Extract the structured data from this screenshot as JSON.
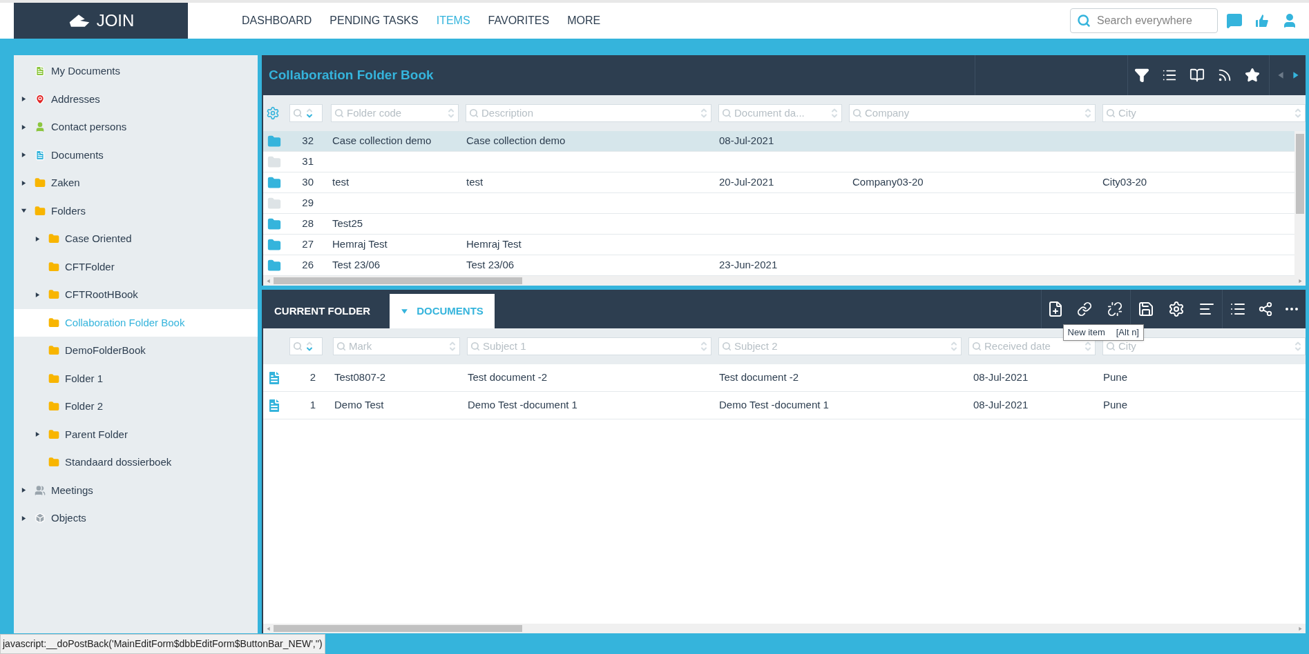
{
  "topbar": {
    "logo": "JOIN",
    "menu": [
      {
        "label": "DASHBOARD",
        "selected": false
      },
      {
        "label": "PENDING TASKS",
        "selected": false
      },
      {
        "label": "ITEMS",
        "selected": true
      },
      {
        "label": "FAVORITES",
        "selected": false
      },
      {
        "label": "MORE",
        "selected": false
      }
    ],
    "search": {
      "placeholder": "Search everywhere"
    }
  },
  "sidebar": {
    "items": [
      {
        "label": "My Documents",
        "kind": "document",
        "selected": false
      },
      {
        "label": "Addresses",
        "kind": "pin",
        "expanded": false,
        "selected": false
      },
      {
        "label": "Contact persons",
        "kind": "person",
        "expanded": false,
        "selected": false
      },
      {
        "label": "Documents",
        "kind": "file",
        "expanded": false,
        "selected": false
      },
      {
        "label": "Zaken",
        "kind": "folder",
        "expanded": false,
        "selected": false
      },
      {
        "label": "Folders",
        "kind": "folder",
        "expanded": true,
        "selected": false,
        "children": [
          {
            "label": "Case Oriented",
            "kind": "folder",
            "expanded": false,
            "selected": false
          },
          {
            "label": "CFTFolder",
            "kind": "folder",
            "selected": false
          },
          {
            "label": "CFTRootHBook",
            "kind": "folder",
            "expanded": false,
            "selected": false
          },
          {
            "label": "Collaboration Folder Book",
            "kind": "folder",
            "selected": true
          },
          {
            "label": "DemoFolderBook",
            "kind": "folder",
            "selected": false
          },
          {
            "label": "Folder 1",
            "kind": "folder",
            "selected": false
          },
          {
            "label": "Folder 2",
            "kind": "folder",
            "selected": false
          },
          {
            "label": "Parent Folder",
            "kind": "folder",
            "expanded": false,
            "selected": false
          },
          {
            "label": "Standaard dossierboek",
            "kind": "folder",
            "selected": false
          }
        ]
      },
      {
        "label": "Meetings",
        "kind": "people",
        "expanded": false,
        "selected": false
      },
      {
        "label": "Objects",
        "kind": "box",
        "expanded": false,
        "selected": false
      }
    ]
  },
  "folder_list": {
    "title": "Collaboration Folder Book",
    "filters": [
      "Folder code",
      "Description",
      "Document da...",
      "Company",
      "City"
    ],
    "rows": [
      {
        "number": "32",
        "folder_code": "Case collection demo",
        "description": "Case collection demo",
        "document_date": "08-Jul-2021",
        "company": "",
        "city": "",
        "empty": false,
        "selected": true
      },
      {
        "number": "31",
        "folder_code": "",
        "description": "",
        "document_date": "",
        "company": "",
        "city": "",
        "empty": true,
        "selected": false
      },
      {
        "number": "30",
        "folder_code": "test",
        "description": "test",
        "document_date": "20-Jul-2021",
        "company": "Company03-20",
        "city": "City03-20",
        "empty": false,
        "selected": false
      },
      {
        "number": "29",
        "folder_code": "",
        "description": "",
        "document_date": "",
        "company": "",
        "city": "",
        "empty": true,
        "selected": false
      },
      {
        "number": "28",
        "folder_code": "Test25",
        "description": "",
        "document_date": "",
        "company": "",
        "city": "",
        "empty": false,
        "selected": false
      },
      {
        "number": "27",
        "folder_code": "Hemraj Test",
        "description": "Hemraj Test",
        "document_date": "",
        "company": "",
        "city": "",
        "empty": false,
        "selected": false
      },
      {
        "number": "26",
        "folder_code": "Test 23/06",
        "description": "Test 23/06",
        "document_date": "23-Jun-2021",
        "company": "",
        "city": "",
        "empty": false,
        "selected": false
      }
    ]
  },
  "documents_panel": {
    "tabs": [
      {
        "label": "CURRENT FOLDER",
        "selected": false
      },
      {
        "label": "DOCUMENTS",
        "selected": true
      }
    ],
    "tooltip": {
      "label": "New item",
      "shortcut": "[Alt n]"
    },
    "filters": [
      "Mark",
      "Subject 1",
      "Subject 2",
      "Received date",
      "City"
    ],
    "rows": [
      {
        "number": "2",
        "mark": "Test0807-2",
        "subject_1": "Test document -2",
        "subject_2": "Test document -2",
        "received_date": "08-Jul-2021",
        "city": "Pune"
      },
      {
        "number": "1",
        "mark": "Demo Test",
        "subject_1": "Demo Test -document 1",
        "subject_2": "Demo Test -document 1",
        "received_date": "08-Jul-2021",
        "city": "Pune"
      }
    ]
  },
  "status_bar": "javascript:__doPostBack('MainEditForm$dbbEditForm$ButtonBar_NEW','')"
}
